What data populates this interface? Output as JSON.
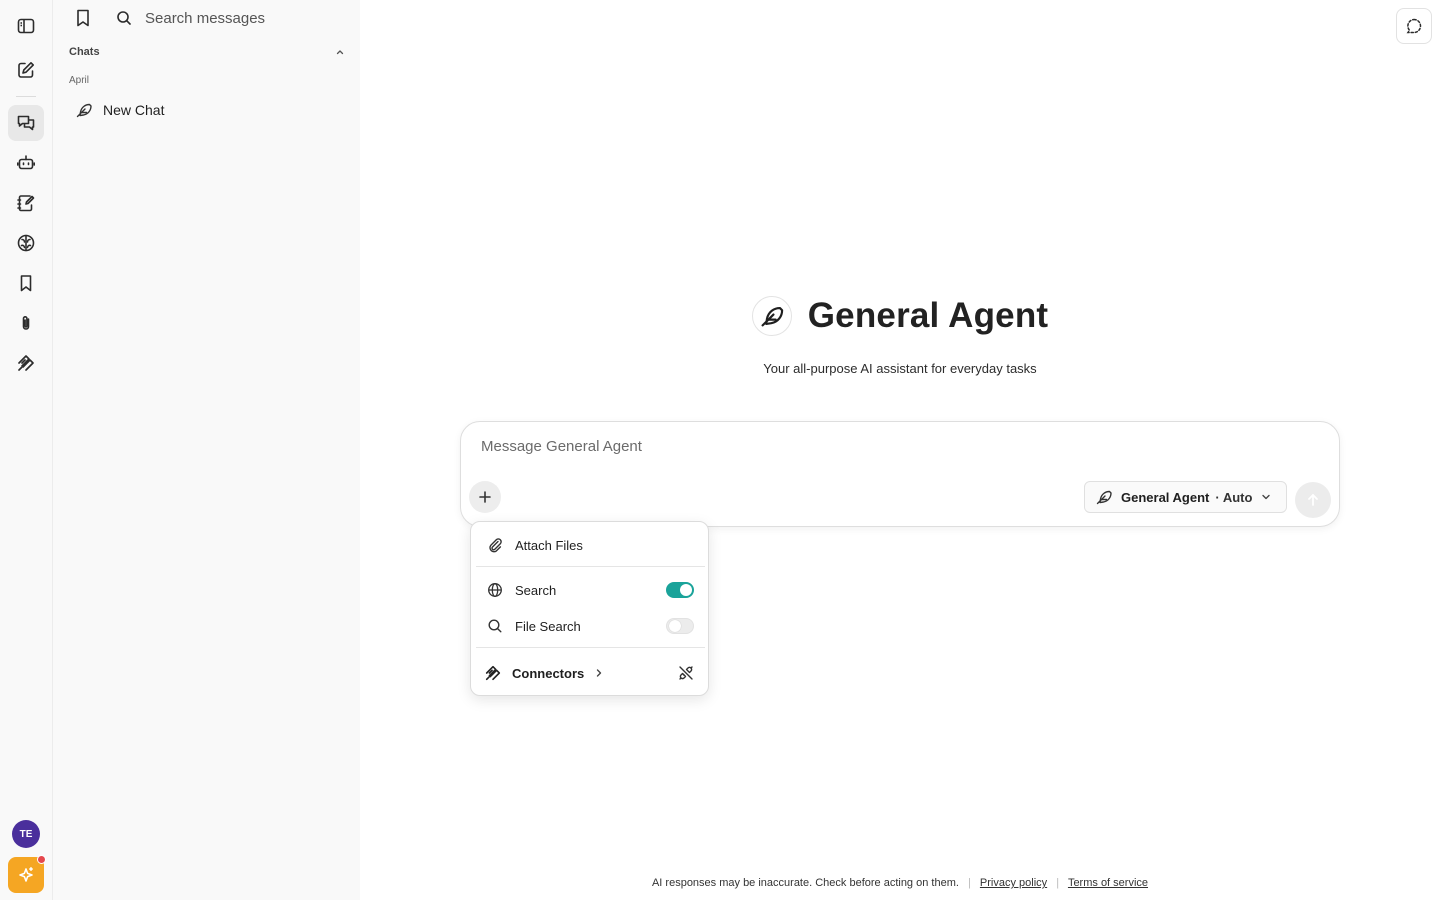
{
  "sidebar": {
    "search_placeholder": "Search messages",
    "section_label": "Chats",
    "group_label": "April",
    "chats": [
      {
        "title": "New Chat"
      }
    ]
  },
  "rail": {
    "avatar_initials": "TE",
    "icons": [
      "sidebar-toggle-icon",
      "compose-icon",
      "chats-icon",
      "bot-icon",
      "prompts-icon",
      "brain-icon",
      "bookmark-icon",
      "paperclip-icon",
      "connectors-icon"
    ]
  },
  "agent": {
    "title": "General Agent",
    "subtitle": "Your all-purpose AI assistant for everyday tasks"
  },
  "composer": {
    "placeholder": "Message General Agent",
    "model_name": "General Agent",
    "model_mode": "· Auto"
  },
  "tools_menu": {
    "attach_label": "Attach Files",
    "search_label": "Search",
    "search_enabled": true,
    "file_search_label": "File Search",
    "file_search_enabled": false,
    "connectors_label": "Connectors"
  },
  "footer": {
    "disclaimer": "AI responses may be inaccurate. Check before acting on them.",
    "privacy_label": "Privacy policy",
    "terms_label": "Terms of service"
  },
  "colors": {
    "toggle_on": "#1aa39a",
    "avatar_bg": "#4a2f9c",
    "spark_bg": "#f5a623",
    "notification_dot": "#e5484d"
  }
}
